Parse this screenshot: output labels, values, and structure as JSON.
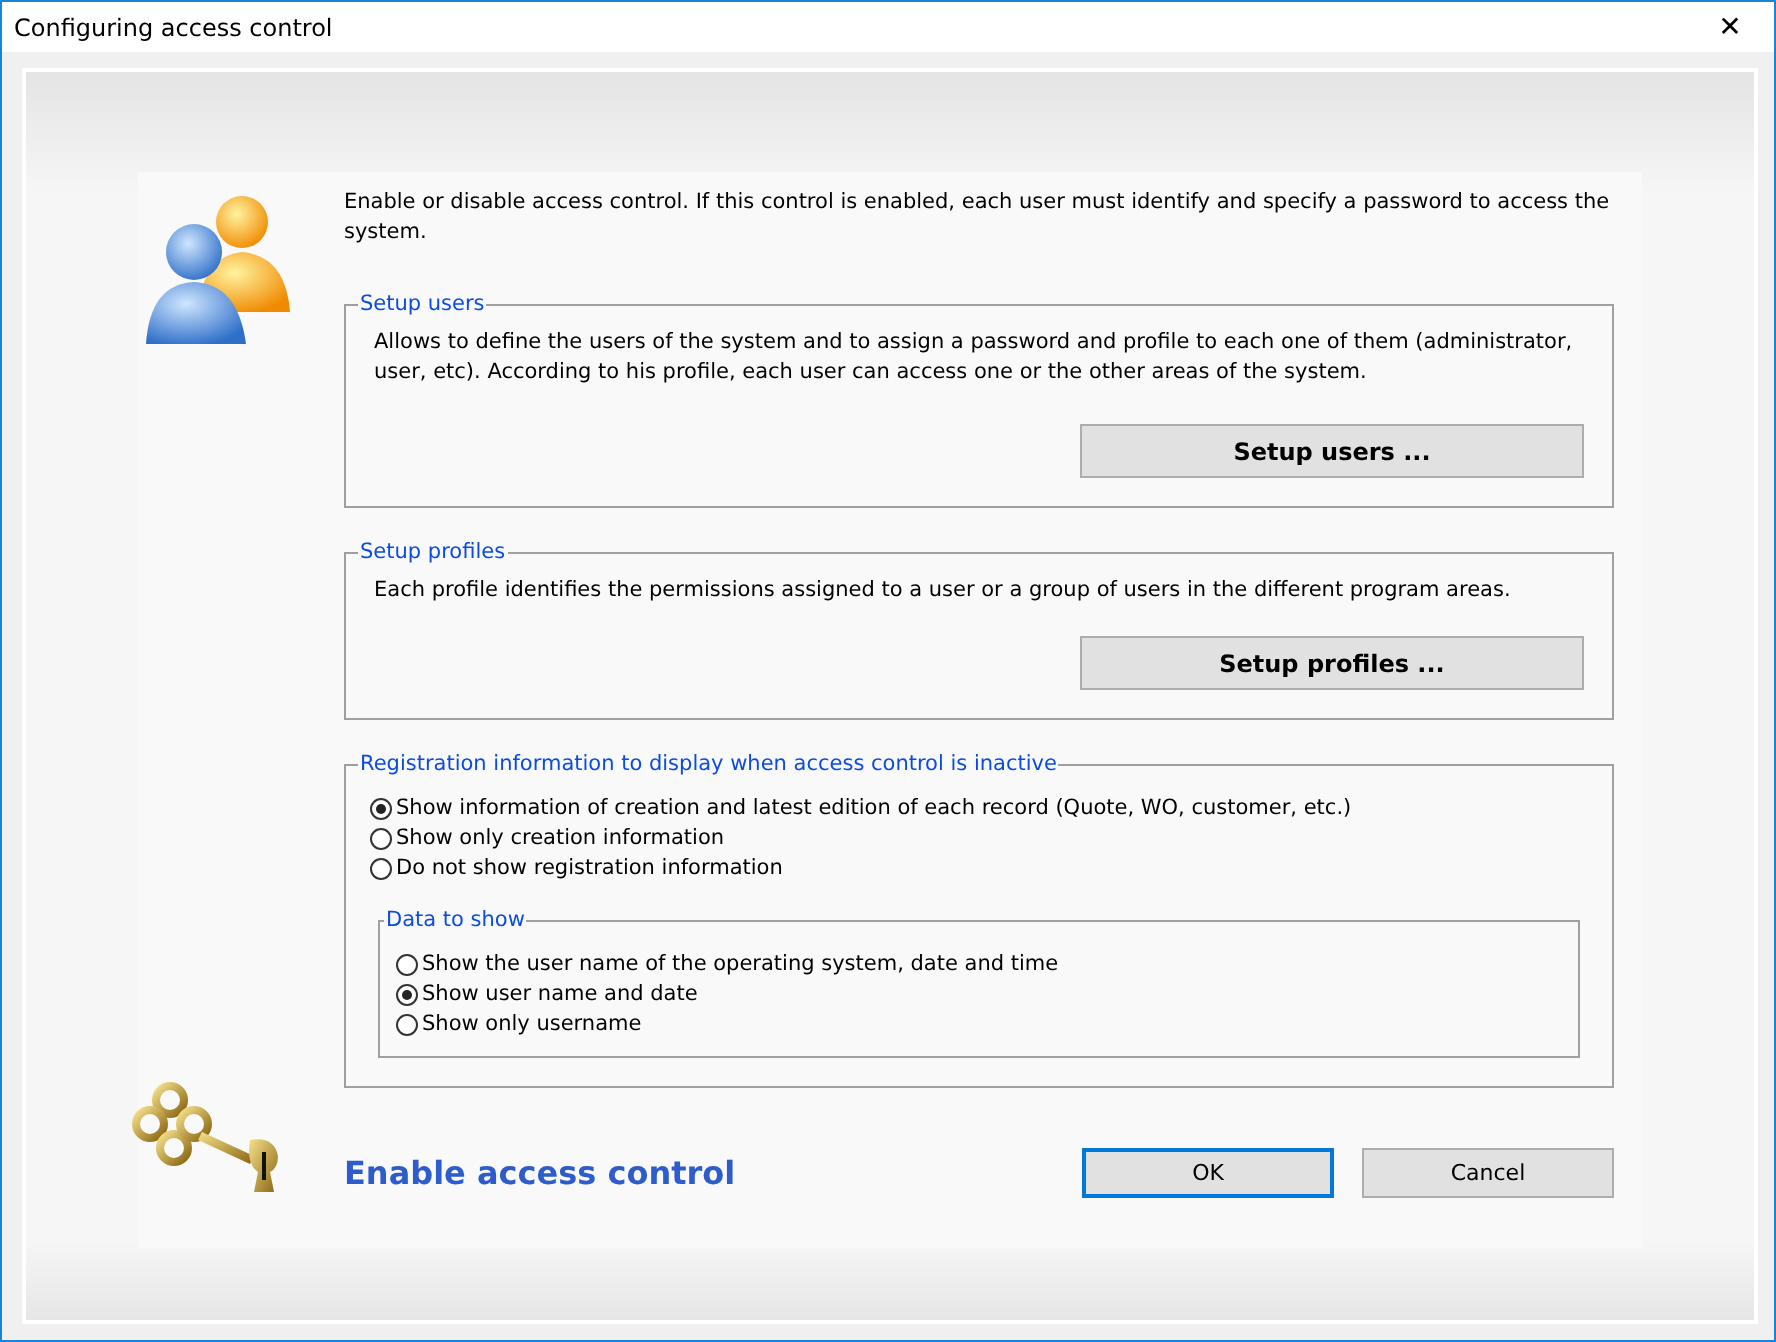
{
  "window": {
    "title": "Configuring access control",
    "close": "✕"
  },
  "intro": "Enable or disable access control. If this control is enabled, each user must identify and specify a password to access the system.",
  "setup_users": {
    "title": "Setup users",
    "text": "Allows to define the users of the system and to assign a password and profile to each one of them (administrator, user, etc). According to his profile, each user can access one or the other areas of the system.",
    "button": "Setup users ..."
  },
  "setup_profiles": {
    "title": "Setup profiles",
    "text": "Each profile identifies the permissions assigned to a user or a group of users in the different program areas.",
    "button": "Setup profiles ..."
  },
  "registration": {
    "title": "Registration information to display when access control is inactive",
    "options": [
      {
        "label": "Show information of creation and latest edition of each record (Quote, WO, customer, etc.)",
        "selected": true
      },
      {
        "label": "Show only creation information",
        "selected": false
      },
      {
        "label": "Do not show registration information",
        "selected": false
      }
    ],
    "data_to_show": {
      "title": "Data to show",
      "options": [
        {
          "label": "Show the user name of the operating system, date and time",
          "selected": false
        },
        {
          "label": "Show user name and date",
          "selected": true
        },
        {
          "label": "Show only username",
          "selected": false
        }
      ]
    }
  },
  "enable_label": "Enable access control",
  "buttons": [
    {
      "label": "OK",
      "focused": true
    },
    {
      "label": "Cancel",
      "focused": false
    }
  ]
}
